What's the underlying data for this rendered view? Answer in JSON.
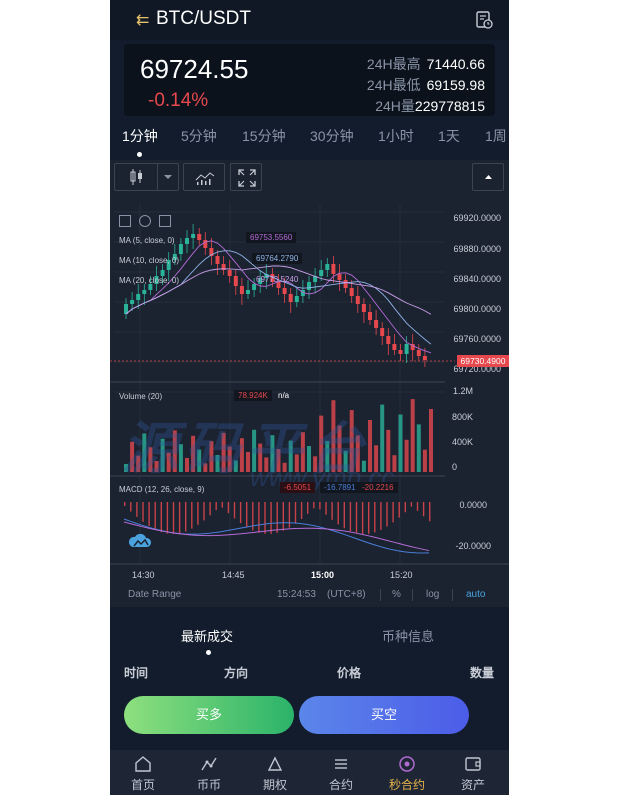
{
  "header": {
    "pair": "BTC/USDT",
    "back_icon": "back-icon",
    "history_icon": "history-icon"
  },
  "ticker": {
    "price": "69724.55",
    "change": "-0.14%",
    "high_label": "24H最高",
    "high": "71440.66",
    "low_label": "24H最低",
    "low": "69159.98",
    "vol_label": "24H量",
    "vol": "229778815"
  },
  "periods": [
    "1分钟",
    "5分钟",
    "15分钟",
    "30分钟",
    "1小时",
    "1天",
    "1周"
  ],
  "active_period": "1分钟",
  "chart": {
    "y_labels": [
      "69920.0000",
      "69880.0000",
      "69840.0000",
      "69800.0000",
      "69760.0000",
      "69720.0000"
    ],
    "last_price": "69730.4900",
    "ma_legends": [
      "MA (5, close, 0)",
      "MA (10, close, 0)",
      "MA (20, close, 0)"
    ],
    "ma_values": [
      "69753.5560",
      "69764.2790",
      "69773.5240"
    ],
    "volume_legend": "Volume (20)",
    "volume_value": "78.924K",
    "volume_na": "n/a",
    "vol_labels": [
      "1.2M",
      "800K",
      "400K",
      "0"
    ],
    "macd_legend": "MACD (12, 26, close, 9)",
    "macd_values": [
      "-6.5051",
      "-16.7891",
      "-20.2216"
    ],
    "macd_labels": [
      "0.0000",
      "-20.0000"
    ],
    "x_labels": [
      "14:30",
      "14:45",
      "15:00",
      "15:20"
    ],
    "date_range": "Date Range",
    "time": "15:24:53",
    "tz": "(UTC+8)",
    "pct": "%",
    "log": "log",
    "auto": "auto",
    "colors": {
      "up": "#2bb39a",
      "down": "#e5484d",
      "accent": "#4aa3df"
    }
  },
  "trades": {
    "tab_latest": "最新成交",
    "tab_info": "币种信息",
    "col_time": "时间",
    "col_dir": "方向",
    "col_price": "价格",
    "col_qty": "数量",
    "buy": "买多",
    "sell": "买空"
  },
  "nav": [
    {
      "label": "首页",
      "icon": "home-icon"
    },
    {
      "label": "币币",
      "icon": "trade-icon"
    },
    {
      "label": "期权",
      "icon": "option-icon"
    },
    {
      "label": "合约",
      "icon": "contract-icon"
    },
    {
      "label": "秒合约",
      "icon": "second-contract-icon"
    },
    {
      "label": "资产",
      "icon": "wallet-icon"
    }
  ],
  "watermark": {
    "text": "源码平台",
    "url": "www.ymp.cc"
  }
}
